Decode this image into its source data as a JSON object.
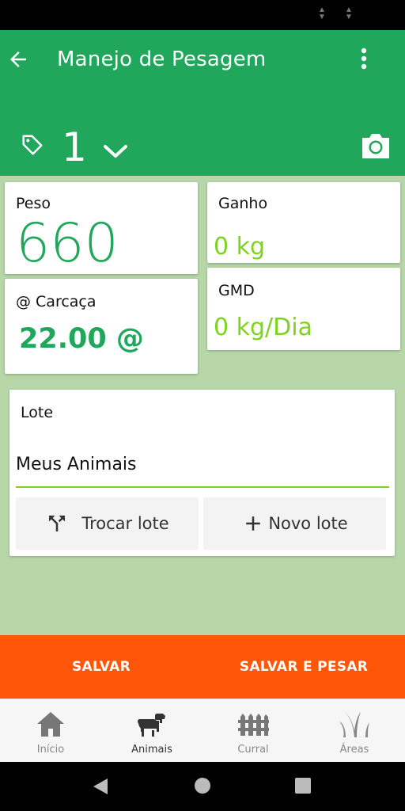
{
  "app_bar": {
    "title": "Manejo de Pesagem",
    "animal_id": "1"
  },
  "cards": {
    "peso": {
      "label": "Peso",
      "value": "660"
    },
    "carcaca": {
      "label": "@ Carcaça",
      "value": "22.00 @"
    },
    "ganho": {
      "label": "Ganho",
      "value": "0 kg"
    },
    "gmd": {
      "label": "GMD",
      "value": "0 kg/Dia"
    }
  },
  "lote": {
    "label": "Lote",
    "current": "Meus Animais",
    "swap_label": "Trocar lote",
    "new_label": "Novo lote"
  },
  "actions": {
    "save": "SALVAR",
    "save_and_weigh": "SALVAR E PESAR"
  },
  "bottom_nav": [
    {
      "label": "Início",
      "icon": "home-icon"
    },
    {
      "label": "Animais",
      "icon": "cattle-icon"
    },
    {
      "label": "Curral",
      "icon": "fence-icon"
    },
    {
      "label": "Áreas",
      "icon": "grass-icon"
    }
  ],
  "colors": {
    "primary": "#20a75b",
    "accent": "#7ed321",
    "action": "#ff560a",
    "content_bg": "#b7d7a8"
  }
}
